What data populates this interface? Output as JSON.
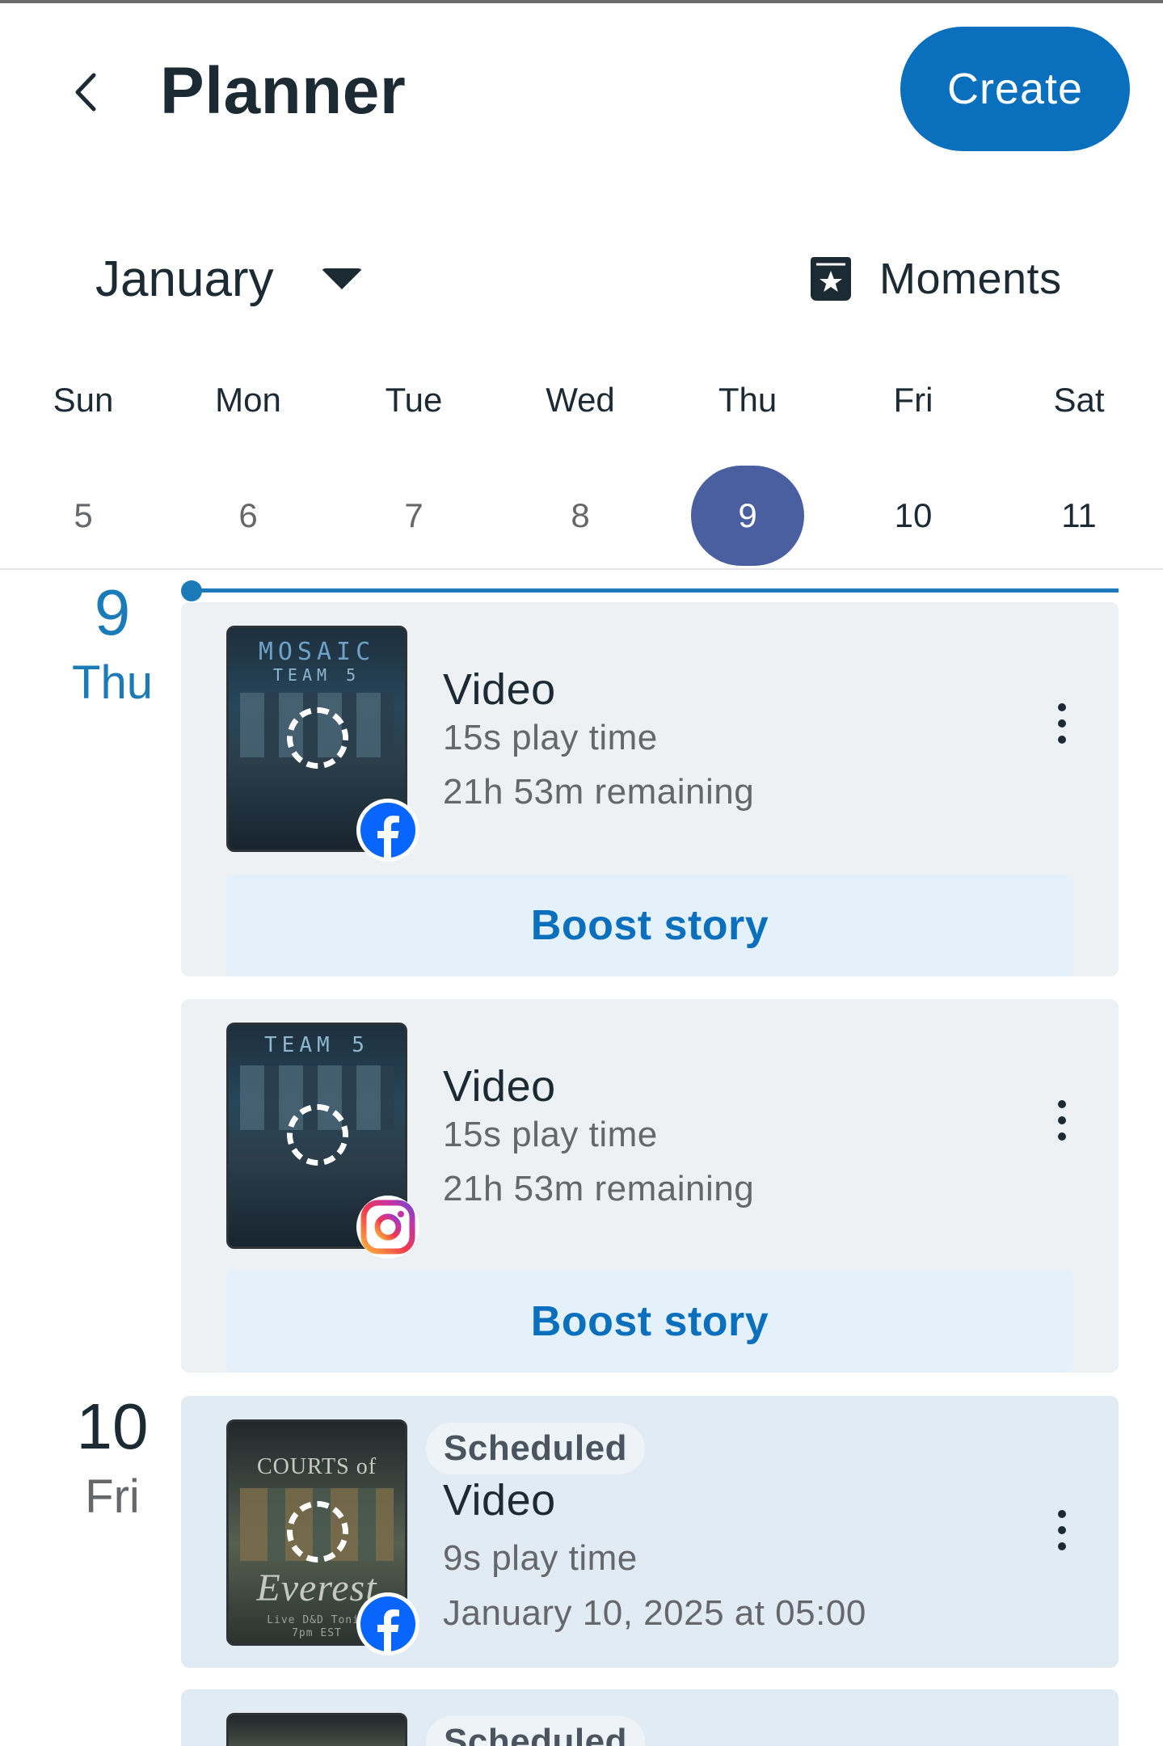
{
  "header": {
    "title": "Planner",
    "create_label": "Create"
  },
  "month_row": {
    "month": "January",
    "moments_label": "Moments"
  },
  "week": [
    {
      "name": "Sun",
      "num": "5"
    },
    {
      "name": "Mon",
      "num": "6"
    },
    {
      "name": "Tue",
      "num": "7"
    },
    {
      "name": "Wed",
      "num": "8"
    },
    {
      "name": "Thu",
      "num": "9"
    },
    {
      "name": "Fri",
      "num": "10"
    },
    {
      "name": "Sat",
      "num": "11"
    }
  ],
  "timeline": {
    "day1": {
      "num": "9",
      "dow": "Thu"
    },
    "day2": {
      "num": "10",
      "dow": "Fri"
    }
  },
  "posts": [
    {
      "type": "Video",
      "play_time": "15s play time",
      "remaining": "21h 53m remaining",
      "boost_label": "Boost story",
      "platform": "facebook-icon",
      "thumb_title": "MOSAIC",
      "thumb_sub": "TEAM 5"
    },
    {
      "type": "Video",
      "play_time": "15s play time",
      "remaining": "21h 53m remaining",
      "boost_label": "Boost story",
      "platform": "instagram-icon",
      "thumb_sub": "TEAM 5"
    },
    {
      "status": "Scheduled",
      "type": "Video",
      "play_time": "9s play time",
      "scheduled_for": "January 10, 2025 at 05:00",
      "platform": "facebook-icon",
      "thumb_title": "COURTS of",
      "thumb_sub": "Everest",
      "thumb_small1": "Live D&D Tonig",
      "thumb_small2": "7pm EST"
    },
    {
      "status": "Scheduled"
    }
  ],
  "colors": {
    "accent": "#0a6fbd",
    "today_circle": "#4a5fa0",
    "today_text": "#1b7ab8",
    "card_bg": "#eef1f4",
    "scheduled_card_bg": "#e1ebf4",
    "facebook": "#0866ff"
  }
}
